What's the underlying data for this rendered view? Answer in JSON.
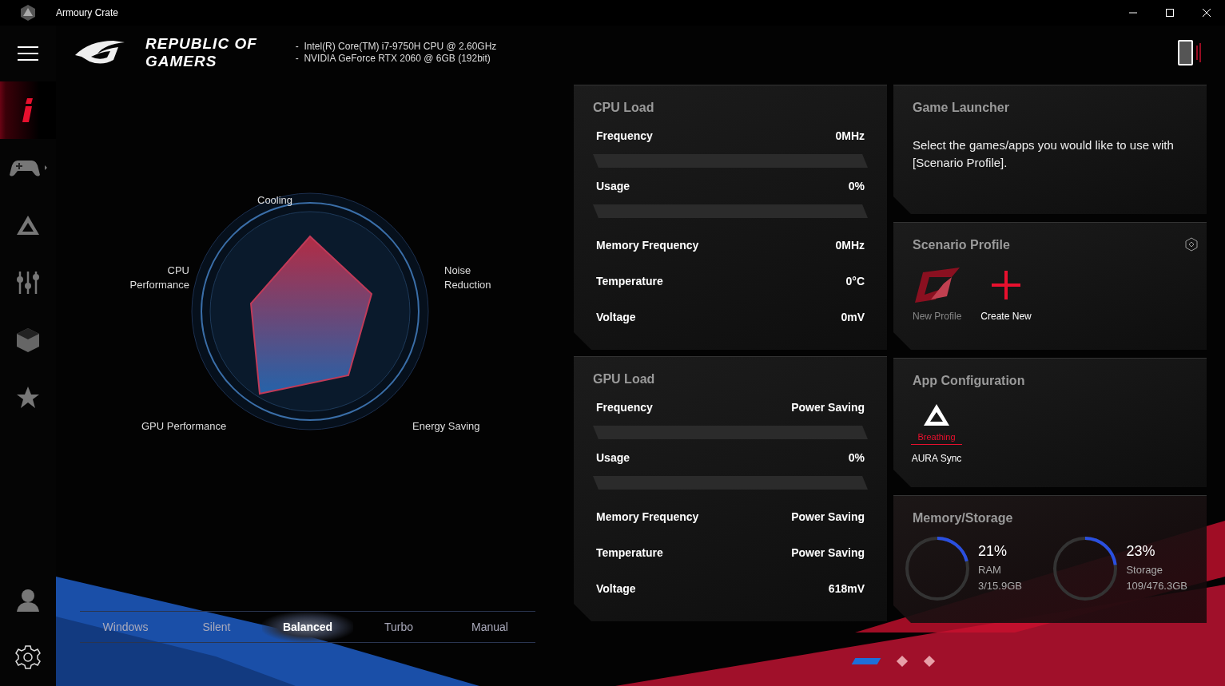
{
  "window": {
    "title": "Armoury Crate"
  },
  "sidebar": {
    "items": [
      {
        "selected": true
      },
      {
        "selected": false
      },
      {
        "selected": false
      },
      {
        "selected": false
      },
      {
        "selected": false
      },
      {
        "selected": false
      },
      {
        "selected": false
      },
      {
        "selected": false
      }
    ]
  },
  "header": {
    "logo_lines": [
      "REPUBLIC OF",
      "GAMERS"
    ],
    "specs": [
      "-  Intel(R) Core(TM) i7-9750H CPU @ 2.60GHz",
      "-  NVIDIA GeForce RTX 2060 @ 6GB (192bit)"
    ]
  },
  "radar": {
    "labels": [
      "Cooling",
      "Noise Reduction",
      "Energy Saving",
      "GPU Performance",
      "CPU Performance"
    ]
  },
  "modes": [
    {
      "label": "Windows",
      "selected": false
    },
    {
      "label": "Silent",
      "selected": false
    },
    {
      "label": "Balanced",
      "selected": true
    },
    {
      "label": "Turbo",
      "selected": false
    },
    {
      "label": "Manual",
      "selected": false
    }
  ],
  "cpu_load": {
    "title": "CPU Load",
    "rows": [
      {
        "kind": "bar",
        "label": "Frequency",
        "value": "0MHz",
        "level": 0
      },
      {
        "kind": "bar",
        "label": "Usage",
        "value": "0%",
        "level": 0
      },
      {
        "kind": "plain",
        "label": "Memory Frequency",
        "value": "0MHz"
      },
      {
        "kind": "plain",
        "label": "Temperature",
        "value": "0°C"
      },
      {
        "kind": "plain",
        "label": "Voltage",
        "value": "0mV"
      }
    ]
  },
  "gpu_load": {
    "title": "GPU Load",
    "rows": [
      {
        "kind": "bar",
        "label": "Frequency",
        "value": "Power Saving",
        "level": 0
      },
      {
        "kind": "bar",
        "label": "Usage",
        "value": "0%",
        "level": 0
      },
      {
        "kind": "plain",
        "label": "Memory Frequency",
        "value": "Power Saving"
      },
      {
        "kind": "plain",
        "label": "Temperature",
        "value": "Power Saving"
      },
      {
        "kind": "plain",
        "label": "Voltage",
        "value": "618mV"
      }
    ]
  },
  "game_launcher": {
    "title": "Game Launcher",
    "text": "Select the games/apps you would like to use with [Scenario Profile]."
  },
  "scenario_profile": {
    "title": "Scenario Profile",
    "items": [
      {
        "kind": "profile",
        "label": "New Profile"
      },
      {
        "kind": "create",
        "label": "Create New"
      }
    ]
  },
  "app_configuration": {
    "title": "App Configuration",
    "apps": [
      {
        "status": "Breathing",
        "label": "AURA Sync"
      }
    ]
  },
  "memory_storage": {
    "title": "Memory/Storage",
    "gauges": [
      {
        "percent": "21%",
        "label": "RAM",
        "detail": "3/15.9GB",
        "level": 0.21
      },
      {
        "percent": "23%",
        "label": "Storage",
        "detail": "109/476.3GB",
        "level": 0.23
      }
    ]
  },
  "pager": [
    {
      "selected": true
    },
    {
      "selected": false
    },
    {
      "selected": false
    }
  ]
}
